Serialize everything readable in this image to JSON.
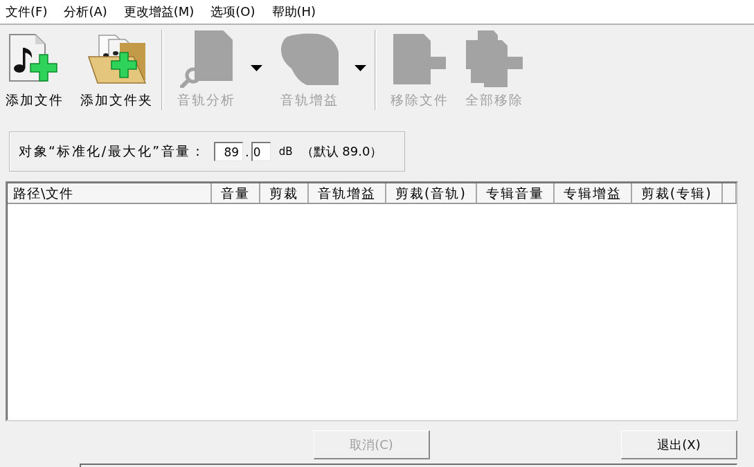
{
  "menu_bar": {
    "items": [
      "文件(F)",
      "分析(A)",
      "更改增益(M)",
      "选项(O)",
      "帮助(H)"
    ]
  },
  "toolbar": {
    "groups": [
      {
        "buttons": [
          {
            "kind": "add-file",
            "label": "添加文件",
            "disabled": false,
            "dropdown": false
          },
          {
            "kind": "add-folder",
            "label": "添加文件夹",
            "disabled": false,
            "dropdown": false
          }
        ]
      },
      {
        "buttons": [
          {
            "kind": "track-analysis",
            "label": "音轨分析",
            "disabled": true,
            "dropdown": true
          },
          {
            "kind": "track-gain",
            "label": "音轨增益",
            "disabled": true,
            "dropdown": true
          }
        ]
      },
      {
        "buttons": [
          {
            "kind": "remove-file",
            "label": "移除文件",
            "disabled": true,
            "dropdown": false
          },
          {
            "kind": "remove-all",
            "label": "全部移除",
            "disabled": true,
            "dropdown": false
          }
        ]
      }
    ]
  },
  "target_volume": {
    "label": "对象“标准化/最大化”音量：",
    "integer_value": "89",
    "separator": ".",
    "decimal_value": "0",
    "unit": "dB",
    "default_note": "（默认 89.0）"
  },
  "file_list": {
    "columns": [
      "路径\\文件",
      "音量",
      "剪裁",
      "音轨增益",
      "剪裁(音轨)",
      "专辑音量",
      "专辑增益",
      "剪裁(专辑)"
    ]
  },
  "buttons": [
    {
      "label": "取消(C)",
      "disabled": true
    },
    {
      "label": "退出(X)",
      "disabled": false
    }
  ]
}
